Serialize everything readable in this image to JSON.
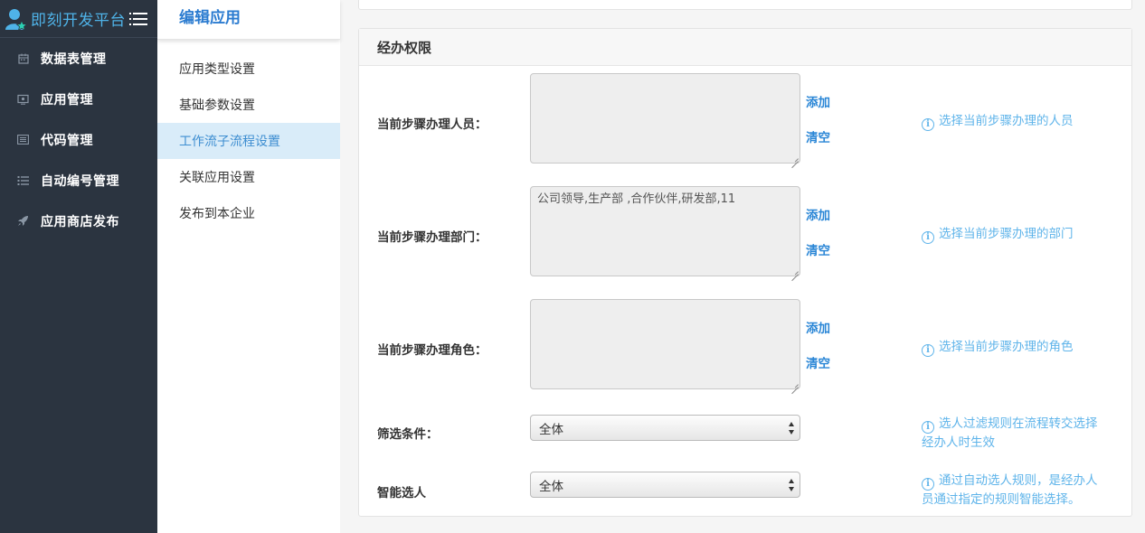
{
  "brand": {
    "title": "即刻开发平台",
    "logo_icon": "user-star-icon",
    "accent": "#4fb3e8"
  },
  "sidebar": {
    "items": [
      {
        "label": "数据表管理",
        "icon": "calendar-icon"
      },
      {
        "label": "应用管理",
        "icon": "monitor-icon"
      },
      {
        "label": "代码管理",
        "icon": "list-card-icon"
      },
      {
        "label": "自动编号管理",
        "icon": "numbered-list-icon"
      },
      {
        "label": "应用商店发布",
        "icon": "rocket-icon"
      }
    ]
  },
  "subpanel": {
    "title": "编辑应用",
    "items": [
      {
        "label": "应用类型设置"
      },
      {
        "label": "基础参数设置"
      },
      {
        "label": "工作流子流程设置",
        "active": true
      },
      {
        "label": "关联应用设置"
      },
      {
        "label": "发布到本企业"
      }
    ]
  },
  "section": {
    "title": "经办权限",
    "fields": [
      {
        "label": "当前步骤办理人员：",
        "value": "",
        "add": "添加",
        "clear": "清空",
        "hint": "选择当前步骤办理的人员"
      },
      {
        "label": "当前步骤办理部门：",
        "value": "公司领导,生产部 ,合作伙伴,研发部,11",
        "add": "添加",
        "clear": "清空",
        "hint": "选择当前步骤办理的部门"
      },
      {
        "label": "当前步骤办理角色：",
        "value": "",
        "add": "添加",
        "clear": "清空",
        "hint": "选择当前步骤办理的角色"
      }
    ],
    "filter": {
      "label": "筛选条件：",
      "selected": "全体",
      "hint_line1": "选人过滤规则在流程转交选择",
      "hint_line2": "经办人时生效"
    },
    "smart": {
      "label": "智能选人",
      "selected": "全体",
      "hint_line1": "通过自动选人规则，是经办人",
      "hint_line2": "员通过指定的规则智能选择。"
    }
  },
  "colors": {
    "sidebar_bg": "#2b3440",
    "active_bg": "#d9ecf9",
    "link": "#2a86d6",
    "hint": "#5fb4ea"
  }
}
